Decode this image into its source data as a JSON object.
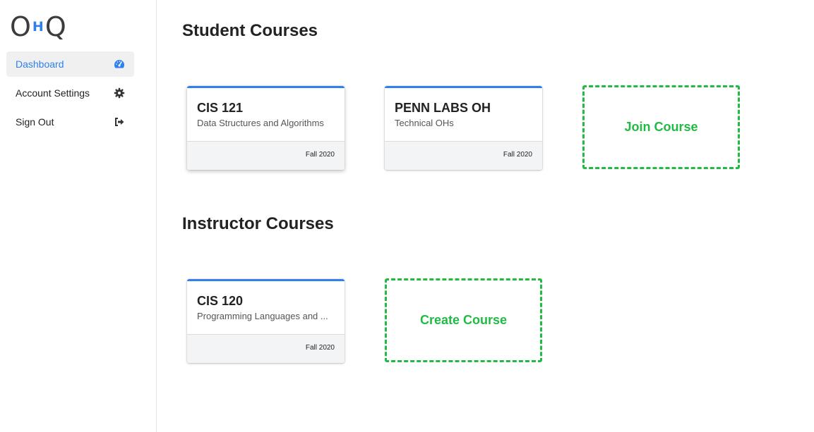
{
  "app": {
    "logo": {
      "left": "O",
      "middle": "H",
      "right": "Q"
    }
  },
  "sidebar": {
    "items": [
      {
        "label": "Dashboard",
        "icon": "dashboard-gauge-icon",
        "active": true
      },
      {
        "label": "Account Settings",
        "icon": "gear-icon",
        "active": false
      },
      {
        "label": "Sign Out",
        "icon": "sign-out-icon",
        "active": false
      }
    ]
  },
  "student": {
    "title": "Student Courses",
    "courses": [
      {
        "code": "CIS 121",
        "name": "Data Structures and Algorithms",
        "term": "Fall 2020"
      },
      {
        "code": "PENN LABS OH",
        "name": "Technical OHs",
        "term": "Fall 2020"
      }
    ],
    "join_label": "Join Course"
  },
  "instructor": {
    "title": "Instructor Courses",
    "courses": [
      {
        "code": "CIS 120",
        "name": "Programming Languages and ...",
        "term": "Fall 2020"
      }
    ],
    "create_label": "Create Course"
  },
  "colors": {
    "accent": "#2f80ed",
    "success": "#21ba45",
    "text": "#222222",
    "muted": "#555555",
    "card_footer": "#f3f4f5"
  }
}
